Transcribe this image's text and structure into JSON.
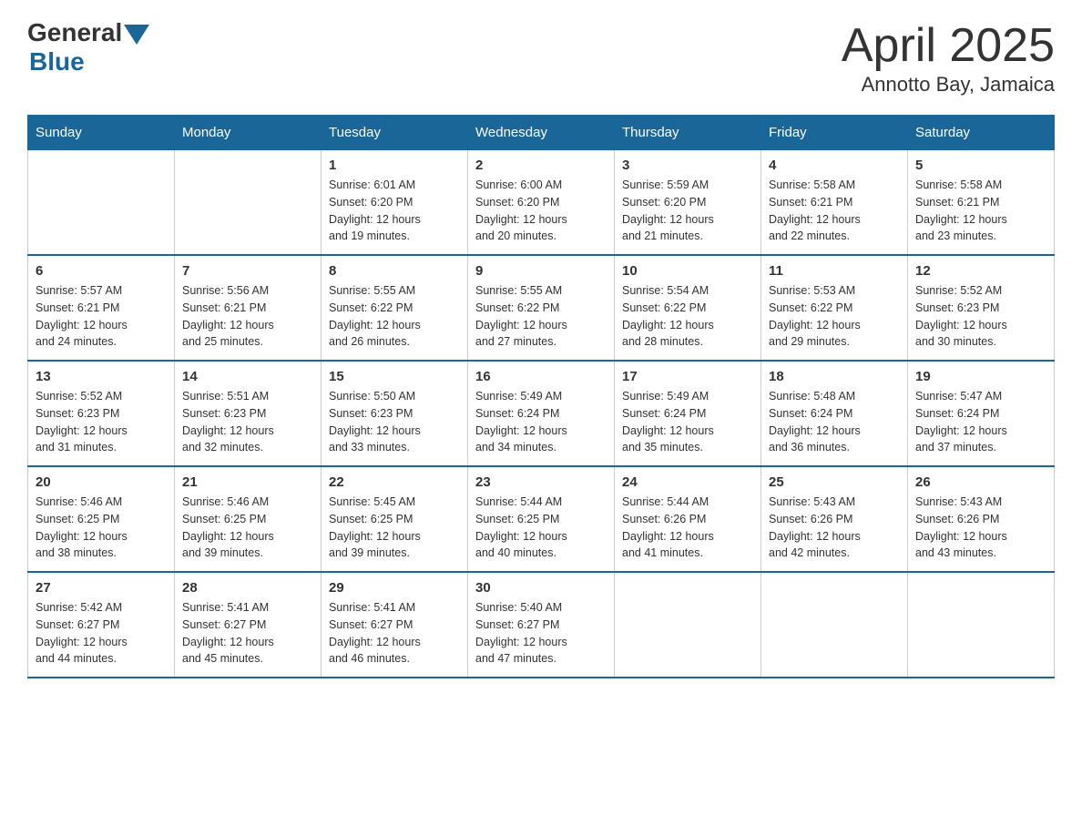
{
  "header": {
    "logo": {
      "general": "General",
      "blue": "Blue",
      "triangle_color": "#1a6699"
    },
    "title": "April 2025",
    "subtitle": "Annotto Bay, Jamaica"
  },
  "calendar": {
    "days_of_week": [
      "Sunday",
      "Monday",
      "Tuesday",
      "Wednesday",
      "Thursday",
      "Friday",
      "Saturday"
    ],
    "weeks": [
      [
        {
          "day": "",
          "info": ""
        },
        {
          "day": "",
          "info": ""
        },
        {
          "day": "1",
          "info": "Sunrise: 6:01 AM\nSunset: 6:20 PM\nDaylight: 12 hours\nand 19 minutes."
        },
        {
          "day": "2",
          "info": "Sunrise: 6:00 AM\nSunset: 6:20 PM\nDaylight: 12 hours\nand 20 minutes."
        },
        {
          "day": "3",
          "info": "Sunrise: 5:59 AM\nSunset: 6:20 PM\nDaylight: 12 hours\nand 21 minutes."
        },
        {
          "day": "4",
          "info": "Sunrise: 5:58 AM\nSunset: 6:21 PM\nDaylight: 12 hours\nand 22 minutes."
        },
        {
          "day": "5",
          "info": "Sunrise: 5:58 AM\nSunset: 6:21 PM\nDaylight: 12 hours\nand 23 minutes."
        }
      ],
      [
        {
          "day": "6",
          "info": "Sunrise: 5:57 AM\nSunset: 6:21 PM\nDaylight: 12 hours\nand 24 minutes."
        },
        {
          "day": "7",
          "info": "Sunrise: 5:56 AM\nSunset: 6:21 PM\nDaylight: 12 hours\nand 25 minutes."
        },
        {
          "day": "8",
          "info": "Sunrise: 5:55 AM\nSunset: 6:22 PM\nDaylight: 12 hours\nand 26 minutes."
        },
        {
          "day": "9",
          "info": "Sunrise: 5:55 AM\nSunset: 6:22 PM\nDaylight: 12 hours\nand 27 minutes."
        },
        {
          "day": "10",
          "info": "Sunrise: 5:54 AM\nSunset: 6:22 PM\nDaylight: 12 hours\nand 28 minutes."
        },
        {
          "day": "11",
          "info": "Sunrise: 5:53 AM\nSunset: 6:22 PM\nDaylight: 12 hours\nand 29 minutes."
        },
        {
          "day": "12",
          "info": "Sunrise: 5:52 AM\nSunset: 6:23 PM\nDaylight: 12 hours\nand 30 minutes."
        }
      ],
      [
        {
          "day": "13",
          "info": "Sunrise: 5:52 AM\nSunset: 6:23 PM\nDaylight: 12 hours\nand 31 minutes."
        },
        {
          "day": "14",
          "info": "Sunrise: 5:51 AM\nSunset: 6:23 PM\nDaylight: 12 hours\nand 32 minutes."
        },
        {
          "day": "15",
          "info": "Sunrise: 5:50 AM\nSunset: 6:23 PM\nDaylight: 12 hours\nand 33 minutes."
        },
        {
          "day": "16",
          "info": "Sunrise: 5:49 AM\nSunset: 6:24 PM\nDaylight: 12 hours\nand 34 minutes."
        },
        {
          "day": "17",
          "info": "Sunrise: 5:49 AM\nSunset: 6:24 PM\nDaylight: 12 hours\nand 35 minutes."
        },
        {
          "day": "18",
          "info": "Sunrise: 5:48 AM\nSunset: 6:24 PM\nDaylight: 12 hours\nand 36 minutes."
        },
        {
          "day": "19",
          "info": "Sunrise: 5:47 AM\nSunset: 6:24 PM\nDaylight: 12 hours\nand 37 minutes."
        }
      ],
      [
        {
          "day": "20",
          "info": "Sunrise: 5:46 AM\nSunset: 6:25 PM\nDaylight: 12 hours\nand 38 minutes."
        },
        {
          "day": "21",
          "info": "Sunrise: 5:46 AM\nSunset: 6:25 PM\nDaylight: 12 hours\nand 39 minutes."
        },
        {
          "day": "22",
          "info": "Sunrise: 5:45 AM\nSunset: 6:25 PM\nDaylight: 12 hours\nand 39 minutes."
        },
        {
          "day": "23",
          "info": "Sunrise: 5:44 AM\nSunset: 6:25 PM\nDaylight: 12 hours\nand 40 minutes."
        },
        {
          "day": "24",
          "info": "Sunrise: 5:44 AM\nSunset: 6:26 PM\nDaylight: 12 hours\nand 41 minutes."
        },
        {
          "day": "25",
          "info": "Sunrise: 5:43 AM\nSunset: 6:26 PM\nDaylight: 12 hours\nand 42 minutes."
        },
        {
          "day": "26",
          "info": "Sunrise: 5:43 AM\nSunset: 6:26 PM\nDaylight: 12 hours\nand 43 minutes."
        }
      ],
      [
        {
          "day": "27",
          "info": "Sunrise: 5:42 AM\nSunset: 6:27 PM\nDaylight: 12 hours\nand 44 minutes."
        },
        {
          "day": "28",
          "info": "Sunrise: 5:41 AM\nSunset: 6:27 PM\nDaylight: 12 hours\nand 45 minutes."
        },
        {
          "day": "29",
          "info": "Sunrise: 5:41 AM\nSunset: 6:27 PM\nDaylight: 12 hours\nand 46 minutes."
        },
        {
          "day": "30",
          "info": "Sunrise: 5:40 AM\nSunset: 6:27 PM\nDaylight: 12 hours\nand 47 minutes."
        },
        {
          "day": "",
          "info": ""
        },
        {
          "day": "",
          "info": ""
        },
        {
          "day": "",
          "info": ""
        }
      ]
    ]
  }
}
